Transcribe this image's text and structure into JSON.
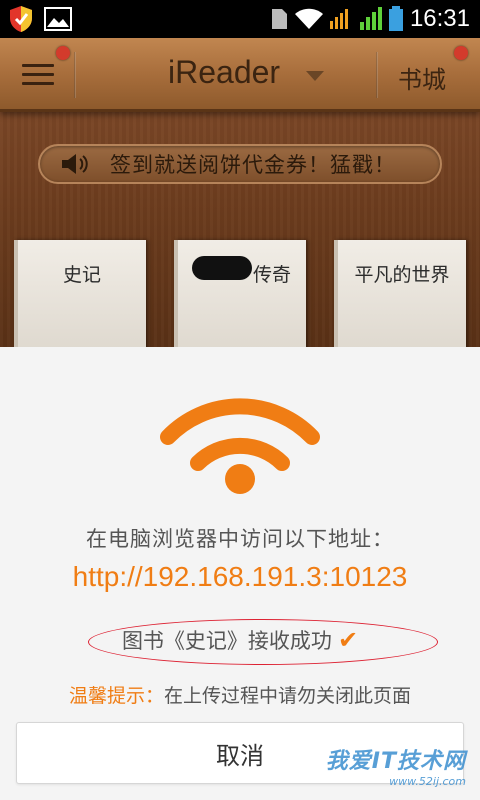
{
  "status_bar": {
    "time": "16:31",
    "icons": [
      "security-shield-icon",
      "image-notification-icon",
      "sd-card-icon",
      "wifi-signal-icon",
      "network-3g-icon",
      "signal-strength-icon",
      "battery-icon"
    ]
  },
  "app": {
    "title": "iReader",
    "store_label": "书城",
    "promo_text": "签到就送阅饼代金券！猛戳！",
    "books": [
      {
        "title": "史记"
      },
      {
        "title": "传奇"
      },
      {
        "title": "平凡的世界"
      }
    ]
  },
  "dialog": {
    "instruction": "在电脑浏览器中访问以下地址：",
    "url": "http://192.168.191.3:10123",
    "success_message": "图书《史记》接收成功",
    "tip_label": "温馨提示：",
    "tip_text": "在上传过程中请勿关闭此页面",
    "cancel_label": "取消"
  },
  "watermark": {
    "text": "我爱IT技术网",
    "sub": "www.52ij.com"
  },
  "colors": {
    "accent": "#f07d14",
    "highlight": "#d22233",
    "wood": "#7a4626"
  }
}
